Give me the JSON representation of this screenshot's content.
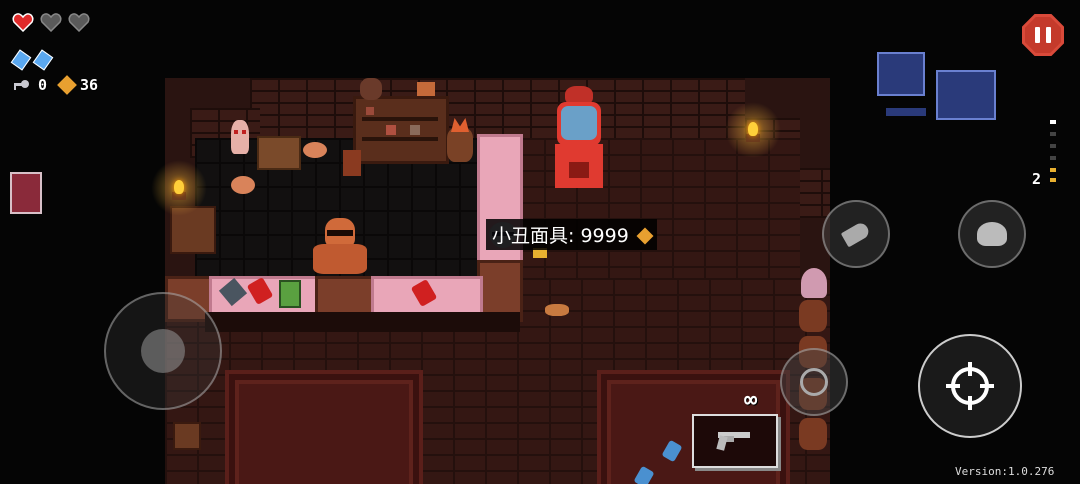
{
  "hud": {
    "hearts": {
      "full": 1,
      "empty": 2
    },
    "blanks": 2,
    "keys": "0",
    "shells": "36",
    "ammo_count": "2",
    "infinite_ammo": "∞",
    "version": "Version:1.0.276"
  },
  "shop": {
    "tooltip_item_name": "小丑面具",
    "tooltip_separator": ":",
    "tooltip_price": "9999"
  },
  "colors": {
    "heart_full": "#e02a2a",
    "heart_empty": "#5a5a5a",
    "pause_red": "#d94a3a",
    "counter_pink": "#e9a6b8",
    "shell_gold": "#e8a030"
  },
  "icons": {
    "pause": "pause-icon",
    "dodge_roll": "dodge-roll-icon",
    "blank": "blank-icon",
    "interact": "hand-icon",
    "aim": "crosshair-icon",
    "gun": "revolver-icon",
    "joystick": "joystick-icon"
  }
}
